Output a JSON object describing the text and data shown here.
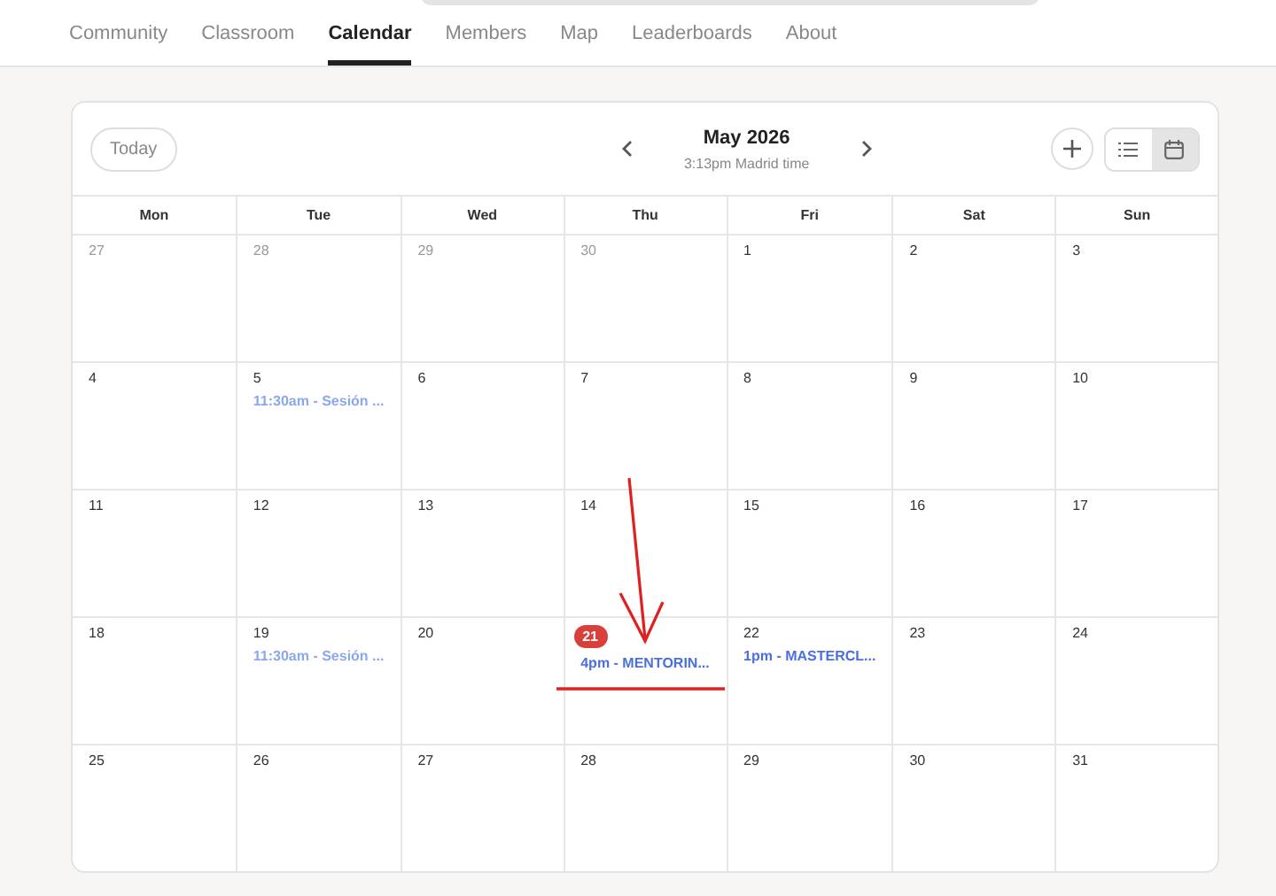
{
  "tabs": [
    {
      "label": "Community",
      "selected": false
    },
    {
      "label": "Classroom",
      "selected": false
    },
    {
      "label": "Calendar",
      "selected": true
    },
    {
      "label": "Members",
      "selected": false
    },
    {
      "label": "Map",
      "selected": false
    },
    {
      "label": "Leaderboards",
      "selected": false
    },
    {
      "label": "About",
      "selected": false
    }
  ],
  "calendar": {
    "today_button": "Today",
    "title": "May 2026",
    "subtitle": "3:13pm Madrid time",
    "view_buttons": [
      {
        "kind": "list",
        "selected": false
      },
      {
        "kind": "month",
        "selected": true
      }
    ],
    "weekdays": [
      "Mon",
      "Tue",
      "Wed",
      "Thu",
      "Fri",
      "Sat",
      "Sun"
    ],
    "weeks": [
      [
        {
          "day": "27",
          "outside": true
        },
        {
          "day": "28",
          "outside": true
        },
        {
          "day": "29",
          "outside": true
        },
        {
          "day": "30",
          "outside": true
        },
        {
          "day": "1",
          "outside": false
        },
        {
          "day": "2",
          "outside": false
        },
        {
          "day": "3",
          "outside": false
        }
      ],
      [
        {
          "day": "4",
          "outside": false
        },
        {
          "day": "5",
          "outside": false,
          "events": [
            {
              "text": "11:30am - Sesión ...",
              "past": true
            }
          ]
        },
        {
          "day": "6",
          "outside": false
        },
        {
          "day": "7",
          "outside": false
        },
        {
          "day": "8",
          "outside": false
        },
        {
          "day": "9",
          "outside": false
        },
        {
          "day": "10",
          "outside": false
        }
      ],
      [
        {
          "day": "11",
          "outside": false
        },
        {
          "day": "12",
          "outside": false
        },
        {
          "day": "13",
          "outside": false
        },
        {
          "day": "14",
          "outside": false
        },
        {
          "day": "15",
          "outside": false
        },
        {
          "day": "16",
          "outside": false
        },
        {
          "day": "17",
          "outside": false
        }
      ],
      [
        {
          "day": "18",
          "outside": false
        },
        {
          "day": "19",
          "outside": false,
          "events": [
            {
              "text": "11:30am - Sesión ...",
              "past": true
            }
          ]
        },
        {
          "day": "20",
          "outside": false
        },
        {
          "day": "21",
          "outside": false,
          "today": true,
          "events": [
            {
              "text": "4pm - MENTORIN...",
              "past": false
            }
          ]
        },
        {
          "day": "22",
          "outside": false,
          "events": [
            {
              "text": "1pm - MASTERCL...",
              "past": false
            }
          ]
        },
        {
          "day": "23",
          "outside": false
        },
        {
          "day": "24",
          "outside": false
        }
      ],
      [
        {
          "day": "25",
          "outside": false
        },
        {
          "day": "26",
          "outside": false
        },
        {
          "day": "27",
          "outside": false
        },
        {
          "day": "28",
          "outside": false
        },
        {
          "day": "29",
          "outside": false
        },
        {
          "day": "30",
          "outside": false
        },
        {
          "day": "31",
          "outside": false
        }
      ]
    ]
  }
}
